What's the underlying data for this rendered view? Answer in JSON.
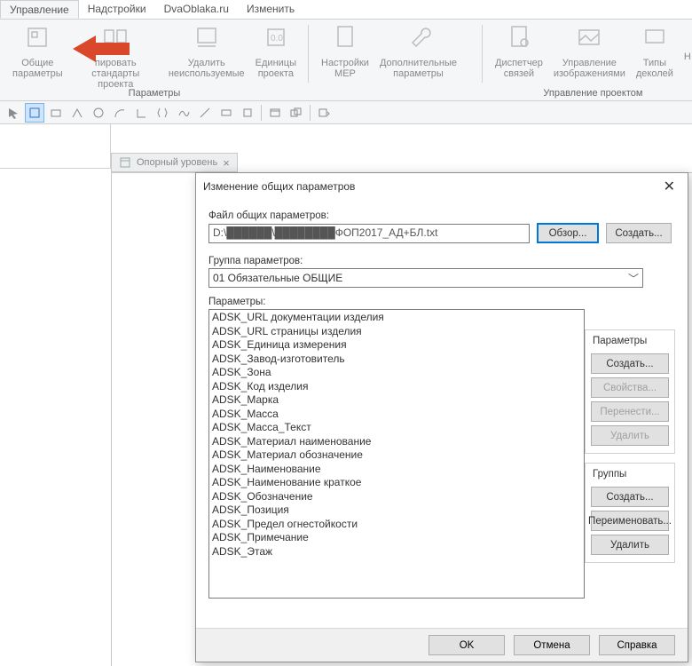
{
  "menu": {
    "tabs": [
      "Управление",
      "Надстройки",
      "DvaOblaka.ru",
      "Изменить"
    ],
    "active": 0
  },
  "ribbon": {
    "items": [
      {
        "label": "Общие\nпараметры"
      },
      {
        "label": "пировать\nстандарты проекта"
      },
      {
        "label": "Удалить\nнеиспользуемые"
      },
      {
        "label": "Единицы\nпроекта"
      },
      {
        "label": "Настройки\nMEP"
      },
      {
        "label": "Дополнительные\nпараметры"
      },
      {
        "label": "Диспетчер\nсвязей"
      },
      {
        "label": "Управление\nизображениями"
      },
      {
        "label": "Типы\nдеколей"
      },
      {
        "label": "Н"
      }
    ],
    "group1_title": "Параметры",
    "group2_title": "Управление проектом"
  },
  "doc_tab": {
    "title": "Опорный уровень"
  },
  "dialog": {
    "title": "Изменение общих параметров",
    "file_label": "Файл общих параметров:",
    "file_value": "D:\\██████\\████████ФОП2017_АД+БЛ.txt",
    "browse": "Обзор...",
    "create": "Создать...",
    "group_label": "Группа параметров:",
    "group_value": "01 Обязательные ОБЩИЕ",
    "params_label": "Параметры:",
    "params": [
      "ADSK_URL документации изделия",
      "ADSK_URL страницы изделия",
      "ADSK_Единица измерения",
      "ADSK_Завод-изготовитель",
      "ADSK_Зона",
      "ADSK_Код изделия",
      "ADSK_Марка",
      "ADSK_Масса",
      "ADSK_Масса_Текст",
      "ADSK_Материал наименование",
      "ADSK_Материал обозначение",
      "ADSK_Наименование",
      "ADSK_Наименование краткое",
      "ADSK_Обозначение",
      "ADSK_Позиция",
      "ADSK_Предел огнестойкости",
      "ADSK_Примечание",
      "ADSK_Этаж"
    ],
    "side_params": {
      "legend": "Параметры",
      "create": "Создать...",
      "props": "Свойства...",
      "move": "Перенести...",
      "delete": "Удалить"
    },
    "side_groups": {
      "legend": "Группы",
      "create": "Создать...",
      "rename": "Переименовать...",
      "delete": "Удалить"
    },
    "footer": {
      "ok": "OK",
      "cancel": "Отмена",
      "help": "Справка"
    }
  }
}
